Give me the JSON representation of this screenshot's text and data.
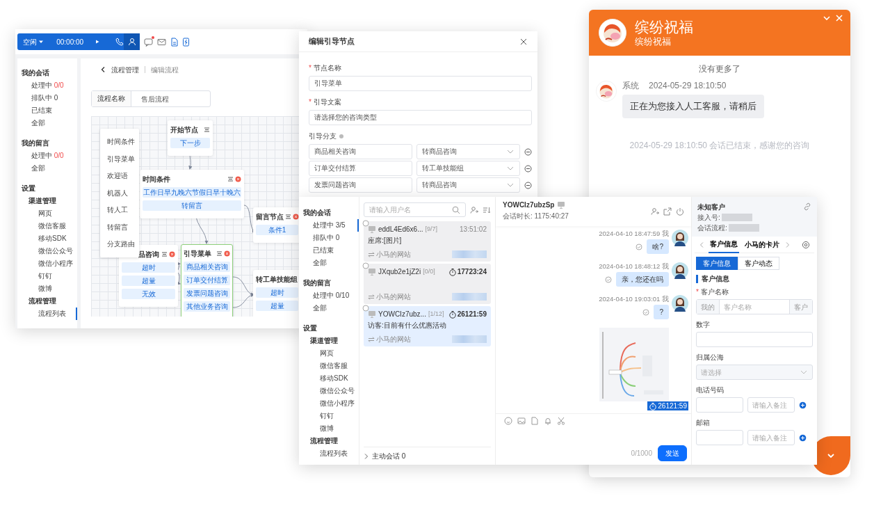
{
  "flow_editor": {
    "toolbar": {
      "status": "空闲",
      "timer": "00:00:00",
      "unread": true
    },
    "sidebar": [
      {
        "label": "我的会话",
        "children": [
          {
            "label": "处理中",
            "count": "0/0",
            "selected": false
          },
          {
            "label": "排队中 0",
            "selected": false
          },
          {
            "label": "已结束",
            "selected": false
          },
          {
            "label": "全部",
            "selected": false
          }
        ]
      },
      {
        "label": "我的留言",
        "children": [
          {
            "label": "处理中",
            "count": "0/0",
            "selected": false
          },
          {
            "label": "全部",
            "selected": false
          }
        ]
      },
      {
        "label": "设置",
        "children": [
          {
            "label": "渠道管理",
            "children": [
              {
                "label": "网页",
                "selected": false
              },
              {
                "label": "微信客服",
                "selected": false
              },
              {
                "label": "移动SDK",
                "selected": false
              },
              {
                "label": "微信公众号",
                "selected": false
              },
              {
                "label": "微信小程序",
                "selected": false
              },
              {
                "label": "钉钉",
                "selected": false
              },
              {
                "label": "微博",
                "selected": false
              }
            ]
          },
          {
            "label": "流程管理",
            "children": [
              {
                "label": "流程列表",
                "selected": true
              }
            ]
          }
        ]
      }
    ],
    "breadcrumb": [
      "流程管理",
      "编辑流程"
    ],
    "flow_name": {
      "label": "流程名称",
      "value": "售后流程"
    },
    "palette": [
      "时间条件",
      "引导菜单",
      "欢迎语",
      "机器人",
      "转人工",
      "转留言",
      "分支路由"
    ],
    "nodes": [
      {
        "title": "开始节点",
        "closable": false,
        "selected": false,
        "chips": [
          "下一步"
        ]
      },
      {
        "title": "时间条件",
        "closable": true,
        "selected": false,
        "chips": [
          "工作日早九晚六节假日早十晚六",
          "转留言"
        ]
      },
      {
        "title": "留言节点",
        "closable": true,
        "selected": false,
        "chips": [
          "条件1"
        ]
      },
      {
        "title": "品咨询",
        "closable": true,
        "selected": false,
        "chips": [
          "超时",
          "超量",
          "无效"
        ]
      },
      {
        "title": "引导菜单",
        "closable": true,
        "selected": true,
        "chips": [
          "商品相关咨询",
          "订单交付结算",
          "发票问题咨询",
          "其他业务咨询"
        ]
      },
      {
        "title": "转工单技能组",
        "closable": false,
        "selected": false,
        "chips": [
          "超时",
          "超量"
        ]
      }
    ]
  },
  "dialog": {
    "title": "编辑引导节点",
    "fields": [
      {
        "label": "节点名称",
        "required_mark": "*",
        "value": "引导菜单"
      },
      {
        "label": "引导文案",
        "required_mark": "*",
        "value": "请选择您的咨询类型"
      }
    ],
    "branches_label": "引导分支",
    "branches": [
      {
        "option": "商品相关咨询",
        "target": "转商品咨询"
      },
      {
        "option": "订单交付结算",
        "target": "转工单技能组"
      },
      {
        "option": "发票问题咨询",
        "target": "转商品咨询"
      }
    ]
  },
  "chat_widget": {
    "title": "缤纷祝福",
    "subtitle": "缤纷祝福",
    "notice": "没有更多了",
    "messages": [
      {
        "sender": "系统",
        "time": "2024-05-29 18:10:50",
        "text": "正在为您接入人工客服，请稍后"
      }
    ],
    "end_notice": "2024-05-29 18:10:50 会话已结束，感谢您的咨询"
  },
  "workbench": {
    "sidebar": [
      {
        "label": "我的会话",
        "children": [
          {
            "label": "处理中 3/5",
            "selected": true
          },
          {
            "label": "排队中 0",
            "selected": false
          },
          {
            "label": "已结束",
            "selected": false
          },
          {
            "label": "全部",
            "selected": false
          }
        ]
      },
      {
        "label": "我的留言",
        "children": [
          {
            "label": "处理中 0/10",
            "selected": false
          },
          {
            "label": "全部",
            "selected": false
          }
        ]
      },
      {
        "label": "设置",
        "children": [
          {
            "label": "渠道管理",
            "children": [
              {
                "label": "网页",
                "selected": false
              },
              {
                "label": "微信客服",
                "selected": false
              },
              {
                "label": "移动SDK",
                "selected": false
              },
              {
                "label": "微信公众号",
                "selected": false
              },
              {
                "label": "微信小程序",
                "selected": false
              },
              {
                "label": "钉钉",
                "selected": false
              },
              {
                "label": "微博",
                "selected": false
              }
            ]
          },
          {
            "label": "流程管理",
            "children": [
              {
                "label": "流程列表",
                "selected": false
              }
            ]
          }
        ]
      }
    ],
    "sessions": {
      "search_placeholder": "请输入用户名",
      "items": [
        {
          "name": "eddL4Ed6x6...",
          "count": "[9/7]",
          "time": "13:51:02",
          "timer": false,
          "preview": "座席:[图片]",
          "source": "小马的网站",
          "selected": false
        },
        {
          "name": "JXqub2e1jZ2i",
          "count": "[0/0]",
          "time": "17723:24",
          "timer": true,
          "source": "小马的网站",
          "selected": false
        },
        {
          "name": "YOWCIz7ubz...",
          "count": "[1/12]",
          "time": "26121:59",
          "timer": true,
          "preview": "访客:目前有什么优惠活动",
          "source": "小马的网站",
          "selected": true
        }
      ],
      "footer": "主动会话 0"
    },
    "chat": {
      "visitor": "YOWCIz7ubzSp",
      "duration": "会话时长: 1175:40:27",
      "messages": [
        {
          "kind": "text",
          "time": "2024-04-10 18:47:59 我",
          "text": "啥?"
        },
        {
          "kind": "text",
          "time": "2024-04-10 18:48:12 我",
          "text": "亲，您还在吗"
        },
        {
          "kind": "text",
          "time": "2024-04-10 19:03:01 我",
          "text": "?"
        },
        {
          "kind": "picture"
        }
      ],
      "timer_badge": "26121:59",
      "counter": "0/1000",
      "send": "发送"
    },
    "customer": {
      "title": "未知客户",
      "meta": [
        "接入号:",
        "会话流程:"
      ],
      "tabs": [
        {
          "label": "客户信息",
          "selected": true
        },
        {
          "label": "小马的卡片",
          "selected": false
        }
      ],
      "segments": [
        {
          "label": "客户信息",
          "selected": true
        },
        {
          "label": "客户动态",
          "selected": false
        }
      ],
      "section": "客户信息",
      "fields": [
        {
          "kind": "group",
          "label": "客户名称",
          "required_mark": "*",
          "prefix": "我的",
          "placeholder": "客户名称",
          "suffix": "客户"
        },
        {
          "kind": "text",
          "label": "数字"
        },
        {
          "kind": "select",
          "label": "归属公海",
          "placeholder": "请选择",
          "disabled": true
        },
        {
          "kind": "pair",
          "label": "电话号码",
          "note_placeholder": "请输入备注"
        },
        {
          "kind": "pair",
          "label": "邮箱",
          "note_placeholder": "请输入备注"
        }
      ]
    }
  }
}
